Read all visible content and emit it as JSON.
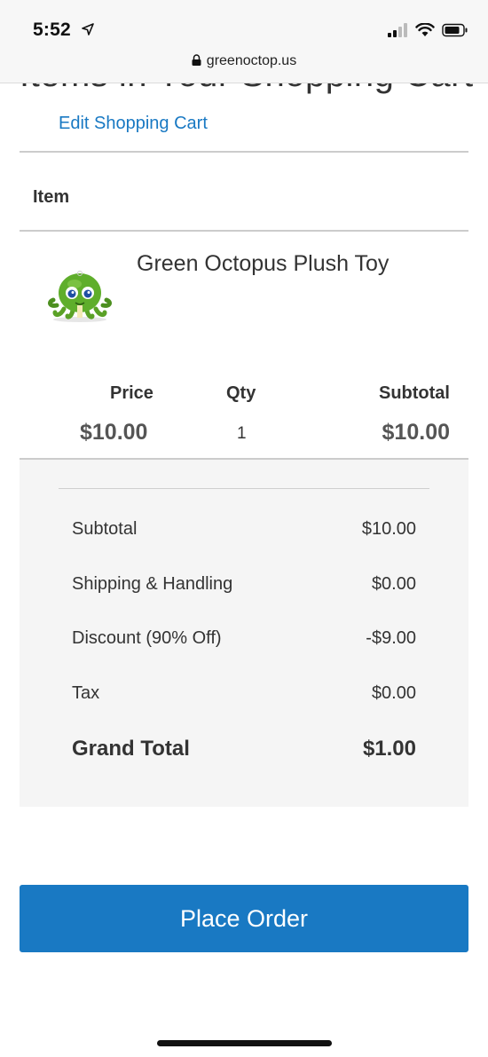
{
  "status_bar": {
    "time": "5:52",
    "url": "greenoctop.us"
  },
  "cart": {
    "heading": "Items in Your Shopping Cart",
    "edit_link": "Edit Shopping Cart",
    "item_header": "Item",
    "product": {
      "name": "Green Octopus Plush Toy",
      "thumbnail_icon": "green-octopus-plush-image"
    },
    "columns": {
      "price_label": "Price",
      "qty_label": "Qty",
      "subtotal_label": "Subtotal",
      "price_value": "$10.00",
      "qty_value": "1",
      "subtotal_value": "$10.00"
    }
  },
  "totals": {
    "rows": [
      {
        "label": "Subtotal",
        "value": "$10.00"
      },
      {
        "label": "Shipping & Handling",
        "value": "$0.00"
      },
      {
        "label": "Discount (90% Off)",
        "value": "-$9.00"
      },
      {
        "label": "Tax",
        "value": "$0.00"
      }
    ],
    "grand_total_label": "Grand Total",
    "grand_total_value": "$1.00"
  },
  "actions": {
    "place_order_label": "Place Order"
  },
  "colors": {
    "accent": "#1979c3",
    "totals_background": "#f5f5f5"
  }
}
